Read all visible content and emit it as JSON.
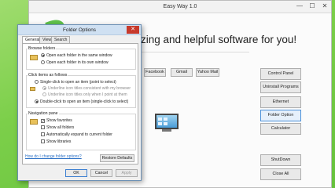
{
  "easyway": {
    "title": "Easy Way 1.0",
    "minimize": "—",
    "maximize": "☐",
    "close": "✕",
    "headline": "zing and helpful software for you!",
    "web_buttons": [
      "Facebook",
      "Gmail",
      "Yahoo Mail"
    ],
    "side_buttons": [
      "Control Panel",
      "Uninstall Programs",
      "Ethernet",
      "Folder Option",
      "Calculator",
      "ShutDown",
      "Close All"
    ]
  },
  "folder_options": {
    "title": "Folder Options",
    "close": "✕",
    "tabs": [
      "General",
      "View",
      "Search"
    ],
    "browse": {
      "label": "Browse folders",
      "options": [
        "Open each folder in the same window",
        "Open each folder in its own window"
      ]
    },
    "click": {
      "label": "Click items as follows",
      "single": "Single-click to open an item (point to select)",
      "underline_browser": "Underline icon titles consistent with my browser",
      "underline_point": "Underline icon titles only when I point at them",
      "double": "Double-click to open an item (single-click to select)"
    },
    "nav": {
      "label": "Navigation pane",
      "checks": [
        "Show favorites",
        "Show all folders",
        "Automatically expand to current folder",
        "Show libraries"
      ],
      "check_mark": "✓"
    },
    "restore_defaults": "Restore Defaults",
    "help_link": "How do I change folder options?",
    "ok": "OK",
    "cancel": "Cancel",
    "apply": "Apply"
  }
}
